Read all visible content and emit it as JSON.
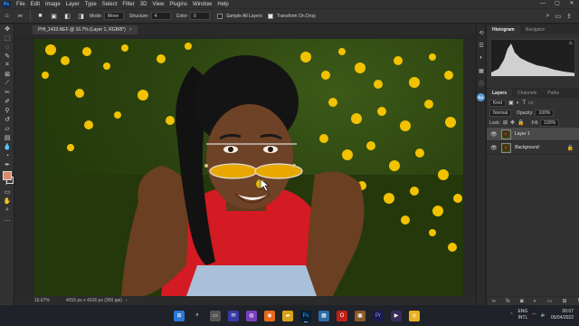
{
  "app": {
    "logo": "Ps",
    "menu": [
      "File",
      "Edit",
      "Image",
      "Layer",
      "Type",
      "Select",
      "Filter",
      "3D",
      "View",
      "Plugins",
      "Window",
      "Help"
    ],
    "window_controls": [
      "—",
      "▢",
      "✕"
    ]
  },
  "options": {
    "mode_label": "Mode:",
    "mode_value": "Move",
    "structure_label": "Structure:",
    "structure_value": "4",
    "color_label": "Color:",
    "color_value": "0",
    "sample_all_layers": "Sample All Layers",
    "sample_all_layers_checked": false,
    "transform_on_drop": "Transform On Drop",
    "transform_on_drop_checked": true
  },
  "document": {
    "tab_title": "PHI_1433.NEF @ 16.7% (Layer 1, RGB/8*)",
    "tab_close": "×"
  },
  "status": {
    "zoom": "16.67%",
    "dimensions": "4016 px x 4016 px (300 ppi)",
    "chevron": "›"
  },
  "panels": {
    "top_tabs": [
      "Histogram",
      "Navigator"
    ],
    "layer_tabs": [
      "Layers",
      "Channels",
      "Paths"
    ],
    "kind_label": "Kind",
    "blend_mode": "Normal",
    "opacity_label": "Opacity:",
    "opacity_value": "100%",
    "lock_label": "Lock:",
    "fill_label": "Fill:",
    "fill_value": "100%",
    "layers": [
      {
        "name": "Layer 1",
        "selected": true,
        "locked": false
      },
      {
        "name": "Background",
        "selected": false,
        "locked": true
      }
    ],
    "histogram_warning": "⚠"
  },
  "taskbar": {
    "lang_top": "ENG",
    "lang_bottom": "INTL",
    "time": "00:07",
    "date": "05/04/2022"
  },
  "colors": {
    "accent": "#31a8ff",
    "foreground_swatch": "#d98a6a",
    "background_swatch": "#3a3a3a",
    "sunglasses": "#e8a800",
    "shirt": "#d41a22"
  }
}
